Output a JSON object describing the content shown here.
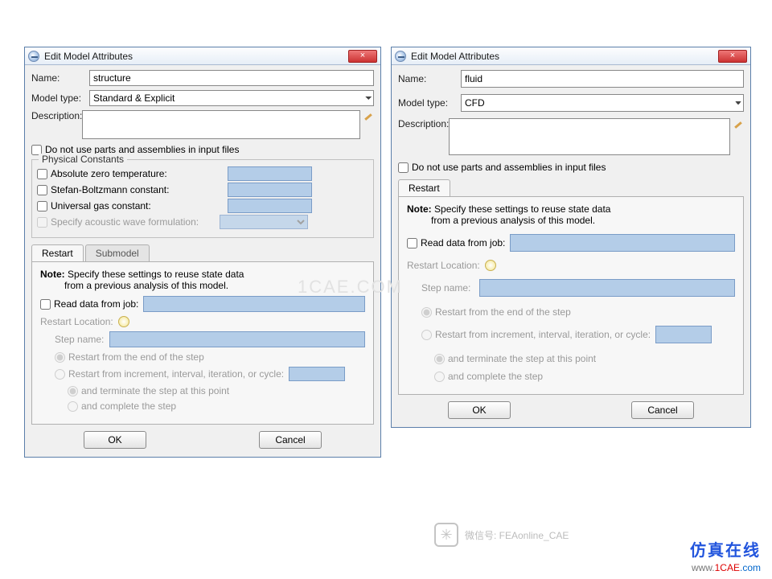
{
  "left": {
    "title": "Edit Model Attributes",
    "name_label": "Name:",
    "name_value": "structure",
    "modeltype_label": "Model type:",
    "modeltype_value": "Standard & Explicit",
    "description_label": "Description:",
    "noparts_label": "Do not use parts and assemblies in input files",
    "pc_label": "Physical Constants",
    "abs_zero": "Absolute zero temperature:",
    "stefan": "Stefan-Boltzmann constant:",
    "ugas": "Universal gas constant:",
    "acoustic": "Specify acoustic wave formulation:",
    "tab_restart": "Restart",
    "tab_submodel": "Submodel",
    "note_label": "Note:",
    "note_text1": "Specify these settings to reuse state data",
    "note_text2": "from a previous analysis of this model.",
    "readjob": "Read data from job:",
    "restart_loc": "Restart Location:",
    "stepname": "Step name:",
    "r1": "Restart from the end of the step",
    "r2": "Restart from increment, interval, iteration, or cycle:",
    "r3": "and terminate the step at this point",
    "r4": "and complete the step",
    "ok": "OK",
    "cancel": "Cancel"
  },
  "right": {
    "title": "Edit Model Attributes",
    "name_label": "Name:",
    "name_value": "fluid",
    "modeltype_label": "Model type:",
    "modeltype_value": "CFD",
    "description_label": "Description:",
    "noparts_label": "Do not use parts and assemblies in input files",
    "tab_restart": "Restart",
    "note_label": "Note:",
    "note_text1": "Specify these settings to reuse state data",
    "note_text2": "from a previous analysis of this model.",
    "readjob": "Read data from job:",
    "restart_loc": "Restart Location:",
    "stepname": "Step name:",
    "r1": "Restart from the end of the step",
    "r2": "Restart from increment, interval, iteration, or cycle:",
    "r3": "and terminate the step at this point",
    "r4": "and complete the step",
    "ok": "OK",
    "cancel": "Cancel"
  },
  "watermark": {
    "wx": "微信号: FEAonline_CAE",
    "center": "1CAE.COM"
  },
  "footer": {
    "cn": "仿真在线",
    "url_prefix": "www.",
    "url_mid": "1CAE",
    "url_suffix": ".com"
  }
}
